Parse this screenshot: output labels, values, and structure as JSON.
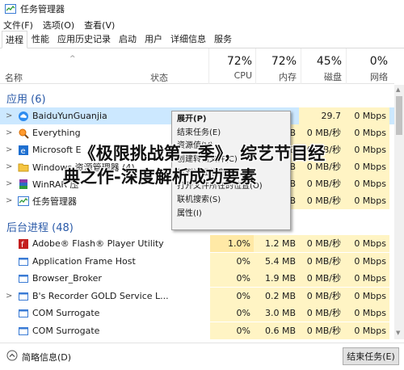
{
  "window": {
    "title": "任务管理器"
  },
  "menu": [
    "文件(F)",
    "选项(O)",
    "查看(V)"
  ],
  "tabs": [
    "进程",
    "性能",
    "应用历史记录",
    "启动",
    "用户",
    "详细信息",
    "服务"
  ],
  "columns": {
    "name": "名称",
    "status": "状态",
    "cpu": {
      "pct": "72%",
      "label": "CPU"
    },
    "memory": {
      "pct": "72%",
      "label": "内存"
    },
    "disk": {
      "pct": "45%",
      "label": "磁盘"
    },
    "network": {
      "pct": "0%",
      "label": "网络"
    }
  },
  "groups": {
    "apps": "应用 (6)",
    "background": "后台进程 (48)"
  },
  "apps": [
    {
      "name": "BaiduYunGuanjia",
      "cpu": "",
      "mem": "",
      "disk": "29.7 MB...",
      "net": "0 Mbps",
      "icon": "cloud-icon"
    },
    {
      "name": "Everything",
      "cpu": "",
      "mem": "MB",
      "disk": "0 MB/秒",
      "net": "0 Mbps",
      "icon": "search-icon"
    },
    {
      "name": "Microsoft E",
      "cpu": "",
      "mem": "MB",
      "disk": "0 MB/秒",
      "net": "0 Mbps",
      "icon": "edge-icon"
    },
    {
      "name": "Windows 资源管理器 (4)",
      "cpu": "",
      "mem": "MB",
      "disk": "0 MB/秒",
      "net": "0 Mbps",
      "icon": "folder-icon"
    },
    {
      "name": "WinRAR 压",
      "cpu": "",
      "mem": "MB",
      "disk": "0 MB/秒",
      "net": "0 Mbps",
      "icon": "winrar-icon"
    },
    {
      "name": "任务管理器",
      "cpu": "",
      "mem": "MB",
      "disk": "0 MB/秒",
      "net": "0 Mbps",
      "icon": "taskmgr-icon"
    }
  ],
  "background": [
    {
      "name": "Adobe® Flash® Player Utility",
      "cpu": "1.0%",
      "mem": "1.2 MB",
      "disk": "0 MB/秒",
      "net": "0 Mbps",
      "icon": "flash-icon"
    },
    {
      "name": "Application Frame Host",
      "cpu": "0%",
      "mem": "5.4 MB",
      "disk": "0 MB/秒",
      "net": "0 Mbps",
      "icon": "app-icon"
    },
    {
      "name": "Browser_Broker",
      "cpu": "0%",
      "mem": "1.9 MB",
      "disk": "0 MB/秒",
      "net": "0 Mbps",
      "icon": "app-icon"
    },
    {
      "name": "B's Recorder GOLD Service L...",
      "cpu": "0%",
      "mem": "0.2 MB",
      "disk": "0 MB/秒",
      "net": "0 Mbps",
      "icon": "app-icon"
    },
    {
      "name": "COM Surrogate",
      "cpu": "0%",
      "mem": "3.0 MB",
      "disk": "0 MB/秒",
      "net": "0 Mbps",
      "icon": "app-icon"
    },
    {
      "name": "COM Surrogate",
      "cpu": "0%",
      "mem": "0.6 MB",
      "disk": "0 MB/秒",
      "net": "0 Mbps",
      "icon": "app-icon"
    }
  ],
  "context_menu": [
    {
      "label": "展开(P)",
      "style": "bold"
    },
    {
      "label": "结束任务(E)",
      "style": ""
    },
    {
      "label": "资源值(V)",
      "style": ""
    },
    {
      "label": "创建转储文件(C)",
      "style": ""
    },
    {
      "label": "转到详细信息(G)",
      "style": ""
    },
    {
      "label": "打开文件所在的位置(O)",
      "style": ""
    },
    {
      "label": "联机搜索(S)",
      "style": ""
    },
    {
      "label": "属性(I)",
      "style": ""
    }
  ],
  "footer": {
    "fewer_details": "简略信息(D)",
    "end_task": "结束任务(E)"
  },
  "overlay": {
    "line1": "《极限挑战第一季》，综艺节目经",
    "line2": "典之作-深度解析成功要素"
  },
  "colors": {
    "accent": "#2a5aa8",
    "selection": "#cce8ff",
    "heat": "#fff4c4"
  }
}
